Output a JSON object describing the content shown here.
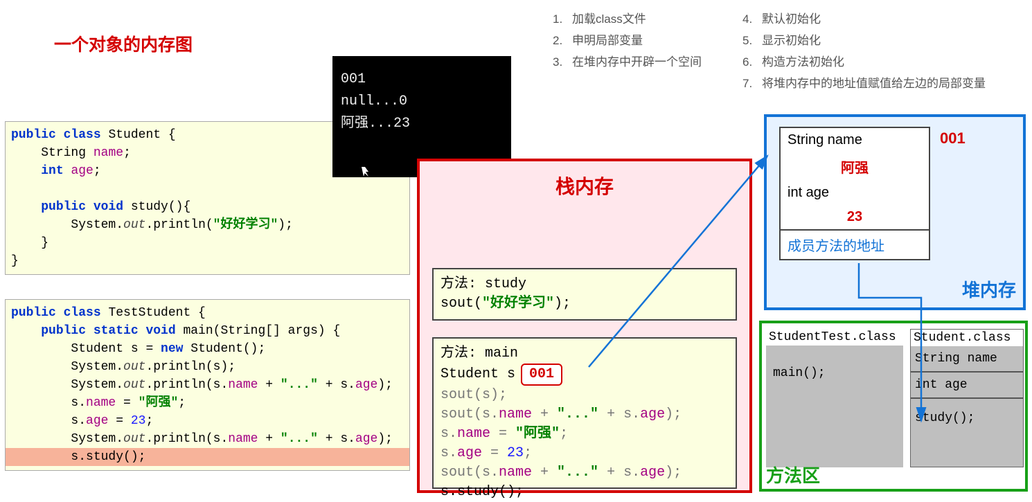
{
  "title": "一个对象的内存图",
  "steps_left": [
    {
      "n": "1.",
      "t": "加载class文件"
    },
    {
      "n": "2.",
      "t": "申明局部变量"
    },
    {
      "n": "3.",
      "t": "在堆内存中开辟一个空间"
    }
  ],
  "steps_right": [
    {
      "n": "4.",
      "t": "默认初始化"
    },
    {
      "n": "5.",
      "t": "显示初始化"
    },
    {
      "n": "6.",
      "t": "构造方法初始化"
    },
    {
      "n": "7.",
      "t": "将堆内存中的地址值赋值给左边的局部变量"
    }
  ],
  "code1": {
    "l1a": "public class ",
    "l1b": "Student {",
    "l2a": "String ",
    "l2b": "name",
    "l2c": ";",
    "l3a": "int ",
    "l3b": "age",
    "l3c": ";",
    "l4a": "public void ",
    "l4b": "study(){",
    "l5a": "System.",
    "l5b": "out",
    "l5c": ".println(",
    "l5d": "\"好好学习\"",
    "l5e": ");",
    "l6": "}",
    "l7": "}"
  },
  "code2": {
    "l1a": "public class ",
    "l1b": "TestStudent {",
    "l2a": "public static void ",
    "l2b": "main(String[] args) {",
    "l3a": "Student s = ",
    "l3b": "new ",
    "l3c": "Student();",
    "l4a": "System.",
    "l4b": "out",
    "l4c": ".println(s);",
    "l5a": "System.",
    "l5b": "out",
    "l5c": ".println(s.",
    "l5d": "name",
    "l5e": " + ",
    "l5f": "\"...\"",
    "l5g": " + s.",
    "l5h": "age",
    "l5i": ");",
    "l6a": "s.",
    "l6b": "name",
    "l6c": " = ",
    "l6d": "\"阿强\"",
    "l6e": ";",
    "l7a": "s.",
    "l7b": "age",
    "l7c": " = ",
    "l7d": "23",
    "l7e": ";",
    "l8a": "System.",
    "l8b": "out",
    "l8c": ".println(s.",
    "l8d": "name",
    "l8e": " + ",
    "l8f": "\"...\"",
    "l8g": " + s.",
    "l8h": "age",
    "l8i": ");",
    "l9": "s.study();"
  },
  "console": {
    "l1": "001",
    "l2": "null...0",
    "l3": "阿强...23"
  },
  "stack": {
    "title": "栈内存",
    "f1_l1": "方法: study",
    "f1_l2a": "sout(",
    "f1_l2b": "\"好好学习\"",
    "f1_l2c": ");",
    "f2_l1": "方法: main",
    "f2_l2a": "Student s",
    "f2_addr": "001",
    "f2_l3": "sout(s);",
    "f2_l4a": "sout(s.",
    "f2_l4b": "name",
    "f2_l4c": " + ",
    "f2_l4d": "\"...\"",
    "f2_l4e": " + s.",
    "f2_l4f": "age",
    "f2_l4g": ");",
    "f2_l5a": "s.",
    "f2_l5b": "name",
    "f2_l5c": " = ",
    "f2_l5d": "\"阿强\"",
    "f2_l5e": ";",
    "f2_l6a": "s.",
    "f2_l6b": "age",
    "f2_l6c": " = ",
    "f2_l6d": "23",
    "f2_l6e": ";",
    "f2_l7a": "sout(s.",
    "f2_l7b": "name",
    "f2_l7c": " + ",
    "f2_l7d": "\"...\"",
    "f2_l7e": " + s.",
    "f2_l7f": "age",
    "f2_l7g": ");",
    "f2_l8": "s.study();"
  },
  "heap": {
    "title": "堆内存",
    "addr": "001",
    "name_label": "String name",
    "name_val": "阿强",
    "age_label": "int age",
    "age_val": "23",
    "method_link": "成员方法的地址"
  },
  "ma": {
    "title": "方法区",
    "cb1_hdr": "StudentTest.class",
    "cb1_body": "main();",
    "cb2_hdr": "Student.class",
    "cb2_s1": "String name",
    "cb2_s2": "int age",
    "cb2_s3": "study();"
  }
}
